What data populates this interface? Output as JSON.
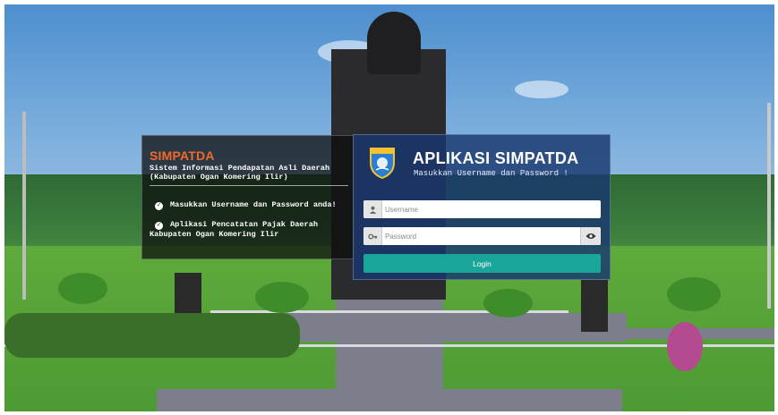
{
  "info_panel": {
    "title": "SIMPATDA",
    "subtitle_line1": "Sistem Informasi Pendapatan Asli Daerah",
    "subtitle_line2": "(Kabupaten Ogan Komering Ilir)",
    "bullets": [
      {
        "icon": "check-circle-icon",
        "text": "Masukkan Username dan Password anda!"
      },
      {
        "icon": "check-circle-icon",
        "line1": "Aplikasi Pencatatan Pajak Daerah",
        "line2": "Kabupaten Ogan Komering Ilir"
      }
    ]
  },
  "login_panel": {
    "logo": "regency-emblem",
    "title": "APLIKASI SIMPATDA",
    "subtitle": "Masukkan Username dan Password !",
    "username": {
      "icon": "user-icon",
      "placeholder": "Username",
      "value": ""
    },
    "password": {
      "icon": "key-icon",
      "placeholder": "Password",
      "value": "",
      "toggle_icon": "eye-icon"
    },
    "button_label": "Login",
    "button_color": "#1aa59a"
  },
  "colors": {
    "brand_title": "#f06a2a",
    "login_panel_bg": "#193770"
  }
}
